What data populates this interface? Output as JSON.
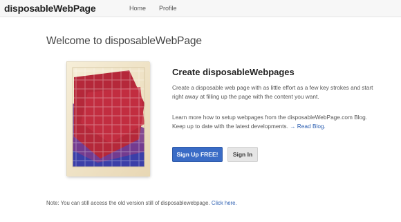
{
  "nav": {
    "brand": "disposableWebPage",
    "links": [
      "Home",
      "Profile"
    ]
  },
  "main": {
    "welcome": "Welcome to disposableWebPage",
    "section_title": "Create disposableWebpages",
    "paragraph1": "Create a disposable web page with as little effort as a few key strokes and start right away at filling up the page with the content you want.",
    "paragraph2": "Learn more how to setup webpages from the disposableWebPage.com Blog. Keep up to date with the latest developments.",
    "read_blog_label": "→ Read Blog.",
    "signup_label": "Sign Up FREE!",
    "signin_label": "Sign In"
  },
  "footer": {
    "note": "Note: You can still access the old version still of disposablewebpage.",
    "click_here_label": "Click here."
  },
  "colors": {
    "primary_button": "#3a6cc6",
    "link": "#2a5db0",
    "illustration_red": "#b5283a",
    "illustration_blue": "#3b3fa8"
  }
}
